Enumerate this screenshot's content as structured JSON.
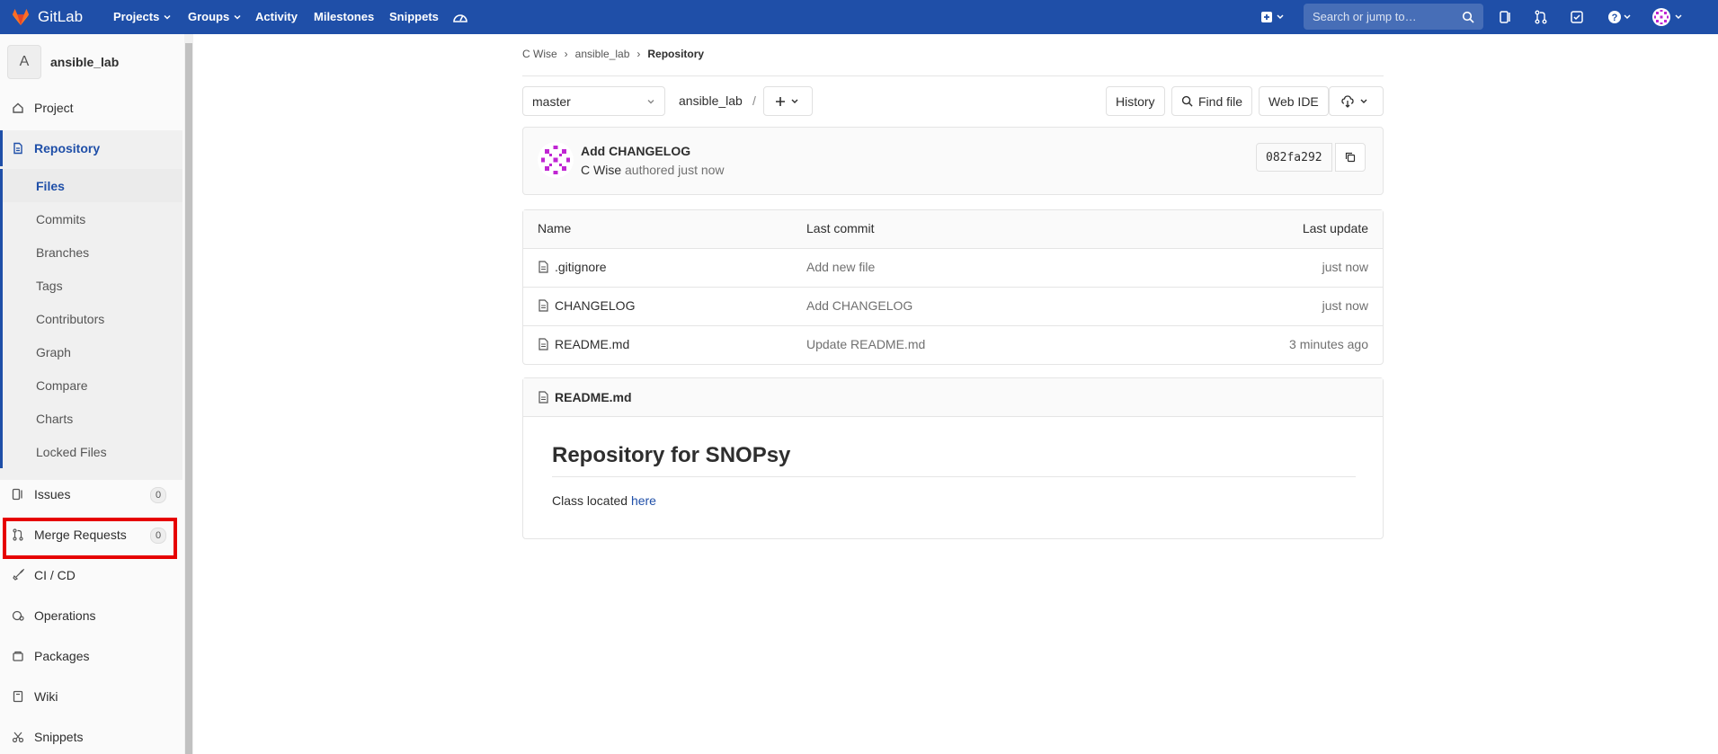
{
  "topnav": {
    "logo_text": "GitLab",
    "items": [
      "Projects",
      "Groups",
      "Activity",
      "Milestones",
      "Snippets"
    ],
    "search_placeholder": "Search or jump to…"
  },
  "sidebar": {
    "project_initial": "A",
    "project_name": "ansible_lab",
    "project_label": "Project",
    "repository_label": "Repository",
    "sub_items": [
      "Files",
      "Commits",
      "Branches",
      "Tags",
      "Contributors",
      "Graph",
      "Compare",
      "Charts",
      "Locked Files"
    ],
    "issues_label": "Issues",
    "issues_count": "0",
    "mr_label": "Merge Requests",
    "mr_count": "0",
    "cicd_label": "CI / CD",
    "operations_label": "Operations",
    "packages_label": "Packages",
    "wiki_label": "Wiki",
    "snippets_label": "Snippets"
  },
  "breadcrumb": {
    "owner": "C Wise",
    "project": "ansible_lab",
    "current": "Repository"
  },
  "toolbar": {
    "branch": "master",
    "path": "ansible_lab",
    "path_sep": "/",
    "history": "History",
    "find_file": "Find file",
    "web_ide": "Web IDE"
  },
  "commit": {
    "title": "Add CHANGELOG",
    "author": "C Wise",
    "meta": "authored just now",
    "sha": "082fa292"
  },
  "files": {
    "headers": [
      "Name",
      "Last commit",
      "Last update"
    ],
    "rows": [
      {
        "name": ".gitignore",
        "commit": "Add new file",
        "updated": "just now"
      },
      {
        "name": "CHANGELOG",
        "commit": "Add CHANGELOG",
        "updated": "just now"
      },
      {
        "name": "README.md",
        "commit": "Update README.md",
        "updated": "3 minutes ago"
      }
    ]
  },
  "readme": {
    "filename": "README.md",
    "heading": "Repository for SNOPsy",
    "text": "Class located",
    "link": "here"
  },
  "colors": {
    "nav": "#1f4fa8",
    "highlight": "#e60000",
    "link": "#1f4fa8"
  }
}
